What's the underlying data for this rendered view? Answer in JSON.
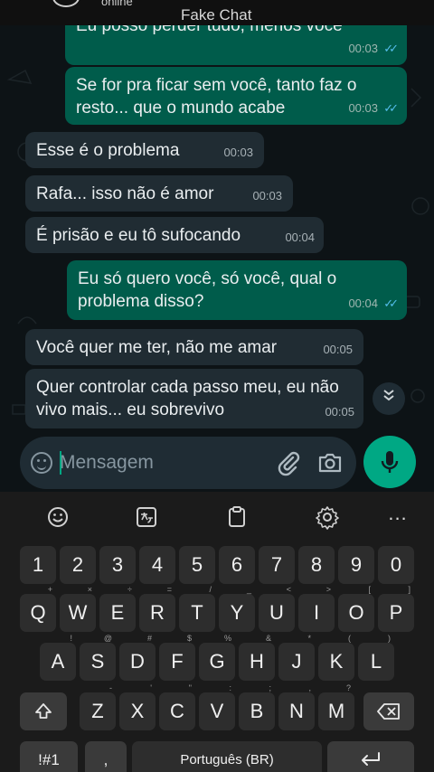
{
  "header": {
    "status_sub": "online",
    "title": "Fake Chat"
  },
  "messages": [
    {
      "dir": "out",
      "text": "Eu posso perder tudo, menos você",
      "time": "00:03",
      "ticks": "✓✓"
    },
    {
      "dir": "out",
      "text": "Se for pra ficar sem você, tanto faz o resto... que o mundo acabe",
      "time": "00:03",
      "ticks": "✓✓"
    },
    {
      "dir": "in",
      "text": "Esse é o problema",
      "time": "00:03"
    },
    {
      "dir": "in",
      "text": "Rafa... isso não é amor",
      "time": "00:03"
    },
    {
      "dir": "in",
      "text": "É prisão e eu tô sufocando",
      "time": "00:04"
    },
    {
      "dir": "out",
      "text": "Eu só quero você, só você, qual o problema disso?",
      "time": "00:04",
      "ticks": "✓✓"
    },
    {
      "dir": "in",
      "text": "Você quer me ter, não me amar",
      "time": "00:05"
    },
    {
      "dir": "in",
      "text": "Quer controlar cada passo meu, eu não vivo mais... eu sobrevivo",
      "time": "00:05"
    }
  ],
  "composer": {
    "placeholder": "Mensagem",
    "value": ""
  },
  "keyboard": {
    "more_label": "...",
    "number_row": [
      "1",
      "2",
      "3",
      "4",
      "5",
      "6",
      "7",
      "8",
      "9",
      "0"
    ],
    "row1": [
      "Q",
      "W",
      "E",
      "R",
      "T",
      "Y",
      "U",
      "I",
      "O",
      "P"
    ],
    "row1_hints": [
      "+",
      "×",
      "÷",
      "=",
      "/",
      "_",
      "<",
      ">",
      "[",
      "]"
    ],
    "row2": [
      "A",
      "S",
      "D",
      "F",
      "G",
      "H",
      "J",
      "K",
      "L"
    ],
    "row2_hints": [
      "!",
      "@",
      "#",
      "$",
      "%",
      "&",
      "*",
      "(",
      ")"
    ],
    "row3": [
      "Z",
      "X",
      "C",
      "V",
      "B",
      "N",
      "M"
    ],
    "row3_hints": [
      "-",
      "'",
      "\"",
      ":",
      ";",
      ",",
      "?"
    ],
    "symbols_label": "!#1",
    "comma_label": ",",
    "space_label": "Português (BR)",
    "colors": {
      "outgoing_bubble": "#005c4b",
      "incoming_bubble": "#202c33",
      "accent": "#00a884",
      "read_ticks": "#53bdeb"
    }
  }
}
